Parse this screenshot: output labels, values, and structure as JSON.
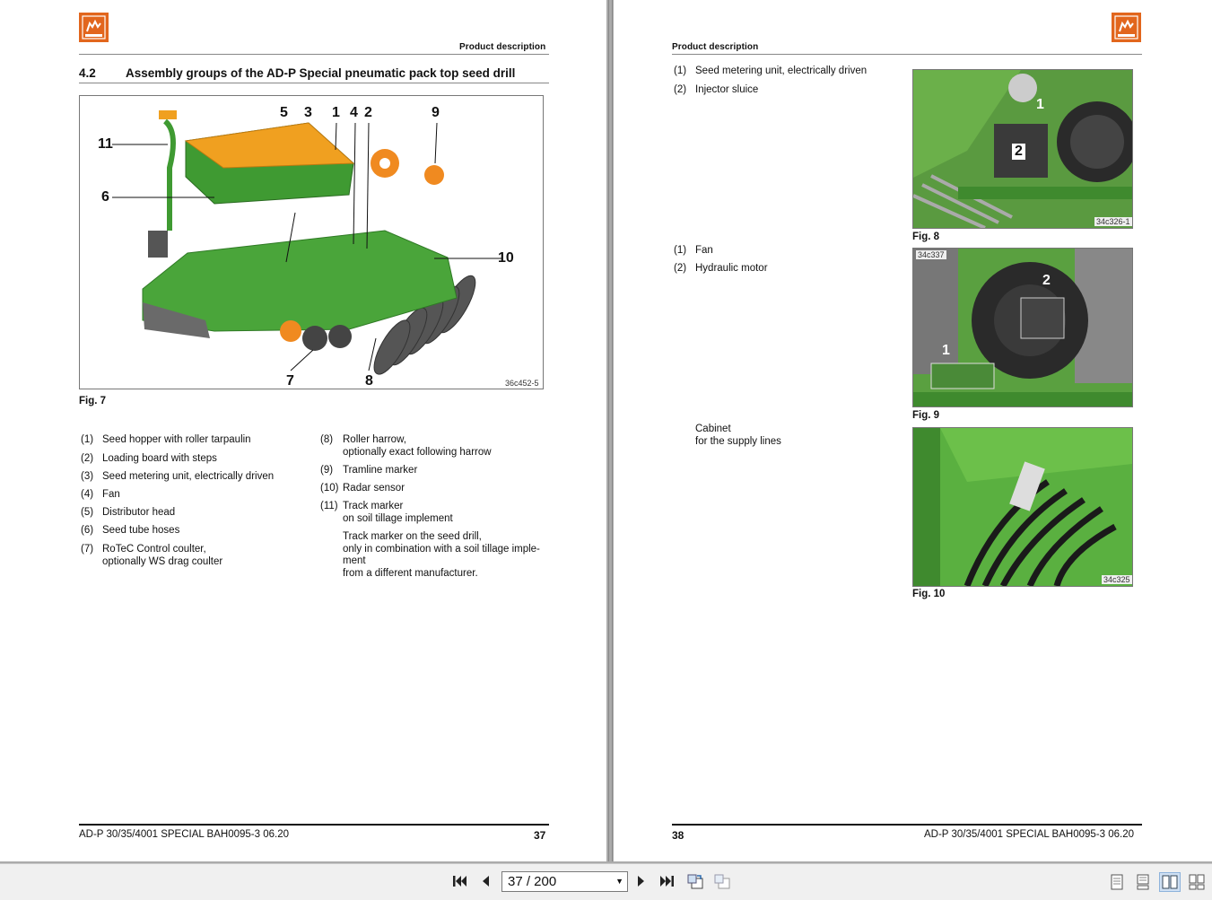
{
  "left_page": {
    "header_label": "Product description",
    "section_number": "4.2",
    "section_title": "Assembly groups of the AD-P Special pneumatic pack top seed drill",
    "figure": {
      "caption": "Fig. 7",
      "code": "36c452-5",
      "callouts": [
        "5",
        "3",
        "1",
        "4",
        "2",
        "9",
        "11",
        "6",
        "10",
        "7",
        "8"
      ]
    },
    "legend_left": [
      {
        "no": "(1)",
        "text": "Seed hopper with roller tarpaulin"
      },
      {
        "no": "(2)",
        "text": "Loading board with steps"
      },
      {
        "no": "(3)",
        "text": "Seed metering unit, electrically driven"
      },
      {
        "no": "(4)",
        "text": "Fan"
      },
      {
        "no": "(5)",
        "text": "Distributor head"
      },
      {
        "no": "(6)",
        "text": "Seed tube hoses"
      },
      {
        "no": "(7)",
        "text": "RoTeC Control coulter,\noptionally WS drag coulter"
      }
    ],
    "legend_right": [
      {
        "no": "(8)",
        "text": "Roller harrow,\noptionally exact following harrow"
      },
      {
        "no": "(9)",
        "text": "Tramline marker"
      },
      {
        "no": "(10)",
        "text": "Radar sensor"
      },
      {
        "no": "(11)",
        "text": "Track marker\non soil tillage implement"
      },
      {
        "no": "",
        "text": "Track marker on the seed drill,\nonly in combination with a soil tillage imple-\nment\nfrom a different manufacturer."
      }
    ],
    "footer_text": "AD-P 30/35/4001 SPECIAL  BAH0095-3  06.20",
    "page_number": "37"
  },
  "right_page": {
    "header_label": "Product description",
    "block1": {
      "items": [
        {
          "no": "(1)",
          "text": "Seed metering unit, electrically driven"
        },
        {
          "no": "(2)",
          "text": "Injector sluice"
        }
      ],
      "caption": "Fig. 8",
      "code": "34c326-1",
      "callouts": [
        "1",
        "2"
      ]
    },
    "block2": {
      "items": [
        {
          "no": "(1)",
          "text": "Fan"
        },
        {
          "no": "(2)",
          "text": "Hydraulic motor"
        }
      ],
      "caption": "Fig. 9",
      "code": "34c337",
      "callouts": [
        "2",
        "1"
      ]
    },
    "block3": {
      "text": "Cabinet\nfor the supply lines",
      "caption": "Fig. 10",
      "code": "34c325"
    },
    "footer_text": "AD-P 30/35/4001 SPECIAL  BAH0095-3  06.20",
    "page_number": "38"
  },
  "toolbar": {
    "page_display": "37 / 200",
    "icons": [
      "first-page-icon",
      "prev-page-icon",
      "next-page-icon",
      "last-page-icon",
      "rotate-icon",
      "rotate-alt-icon",
      "single-page-view-icon",
      "continuous-view-icon",
      "two-page-view-icon",
      "two-page-continuous-icon"
    ]
  },
  "colors": {
    "brand_orange": "#e2661d",
    "machine_green": "#3f9a32",
    "hopper_orange": "#f0a020"
  }
}
